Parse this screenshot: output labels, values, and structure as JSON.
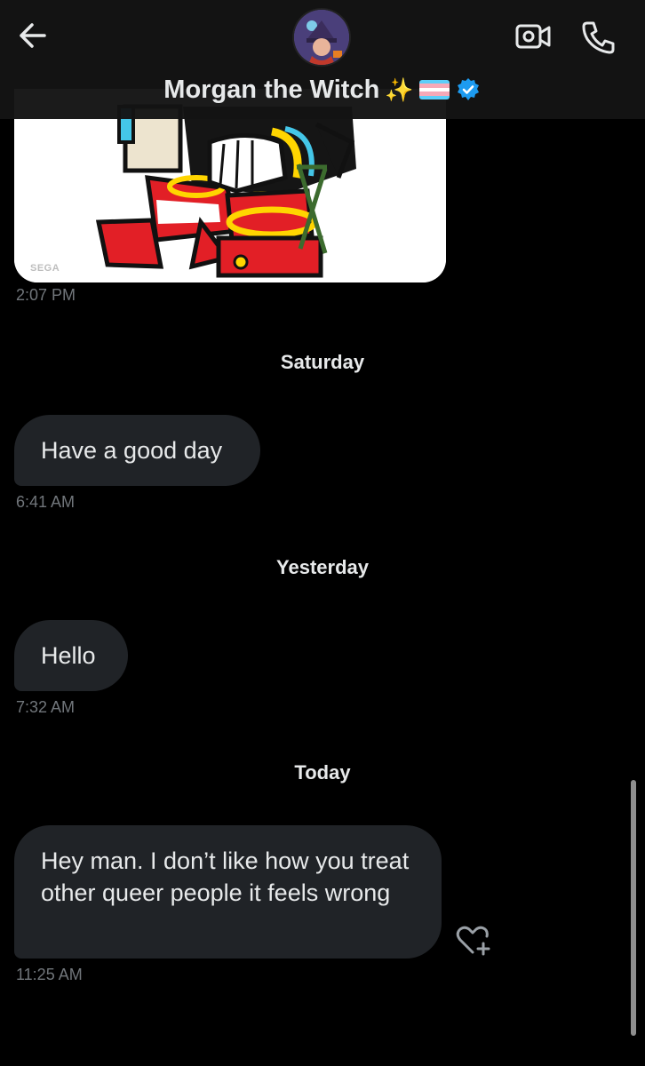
{
  "header": {
    "contact_name": "Morgan the Witch",
    "name_emoji": "✨",
    "flag": {
      "colors": [
        "#5BCEFA",
        "#F5A9B8",
        "#FFFFFF",
        "#F5A9B8",
        "#5BCEFA"
      ]
    },
    "icons": [
      "back-arrow-icon",
      "avatar",
      "video-call-icon",
      "phone-icon",
      "verified-badge-icon"
    ],
    "accent_color": "#1D9BF0"
  },
  "messages": {
    "image_message": {
      "watermark": "SEGA",
      "time": "2:07 PM"
    },
    "day_separators": [
      "Saturday",
      "Yesterday",
      "Today"
    ],
    "items": [
      {
        "text": "Have a good day",
        "time": "6:41 AM"
      },
      {
        "text": "Hello",
        "time": "7:32 AM"
      },
      {
        "text": "Hey man. I don’t like how you treat other queer people it feels wrong",
        "time": "11:25 AM"
      }
    ]
  }
}
